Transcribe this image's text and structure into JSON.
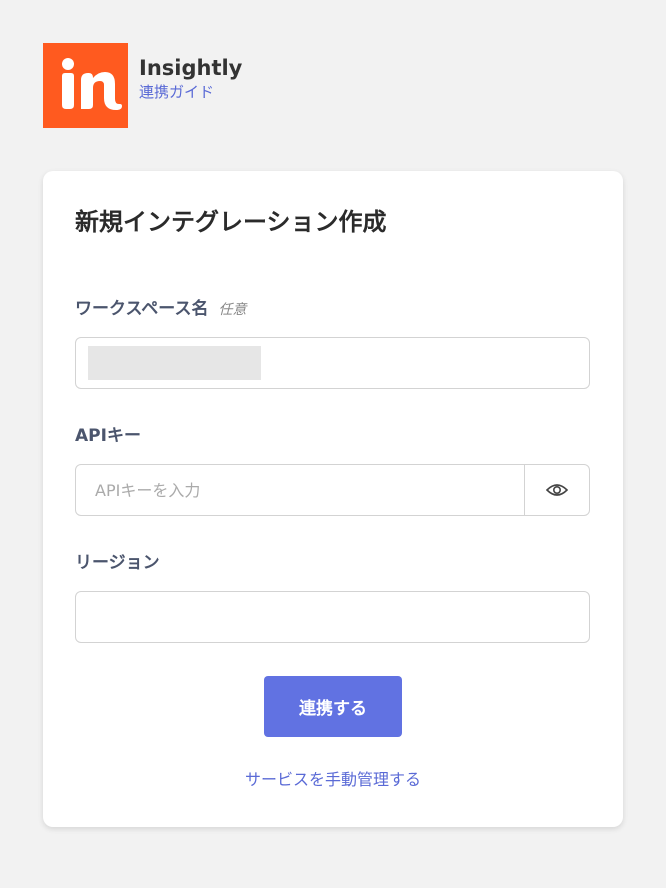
{
  "app": {
    "name": "Insightly",
    "guide_link": "連携ガイド",
    "brand_color": "#ff5a1f",
    "logo_text": "in"
  },
  "form": {
    "title": "新規インテグレーション作成",
    "workspace": {
      "label": "ワークスペース名",
      "optional_tag": "任意",
      "value": ""
    },
    "api_key": {
      "label": "APIキー",
      "placeholder": "APIキーを入力",
      "value": "",
      "toggle_icon": "eye-icon"
    },
    "region": {
      "label": "リージョン",
      "value": ""
    },
    "submit_label": "連携する",
    "manual_link": "サービスを手動管理する",
    "accent_color": "#6172e2"
  }
}
